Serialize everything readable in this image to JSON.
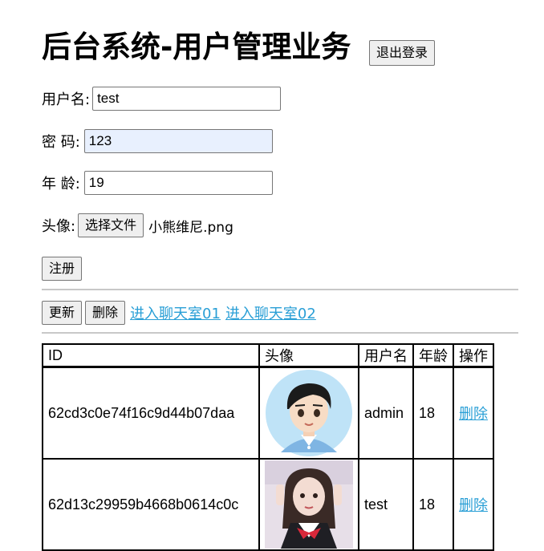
{
  "page": {
    "title": "后台系统-用户管理业务",
    "logout_label": "退出登录"
  },
  "form": {
    "username_label": "用户名:",
    "username_value": "test",
    "password_label": "密 码:",
    "password_value": "123",
    "age_label": "年 龄:",
    "age_value": "19",
    "avatar_label": "头像:",
    "file_button_label": "选择文件",
    "file_name": "小熊维尼.png",
    "register_label": "注册"
  },
  "actions": {
    "update_label": "更新",
    "delete_label": "删除",
    "chat_room_1": "进入聊天室01",
    "chat_room_2": "进入聊天室02"
  },
  "table": {
    "headers": [
      "ID",
      "头像",
      "用户名",
      "年龄",
      "操作"
    ],
    "rows": [
      {
        "id": "62cd3c0e74f16c9d44b07daa",
        "avatar": "cartoon-boy-avatar",
        "username": "admin",
        "age": "18",
        "action": "删除"
      },
      {
        "id": "62d13c29959b4668b0614c0c",
        "avatar": "girl-photo-avatar",
        "username": "test",
        "age": "18",
        "action": "删除"
      }
    ]
  },
  "colors": {
    "link": "#2a9fd6",
    "autofill_bg": "#e8f0fe",
    "button_bg": "#efefef"
  }
}
